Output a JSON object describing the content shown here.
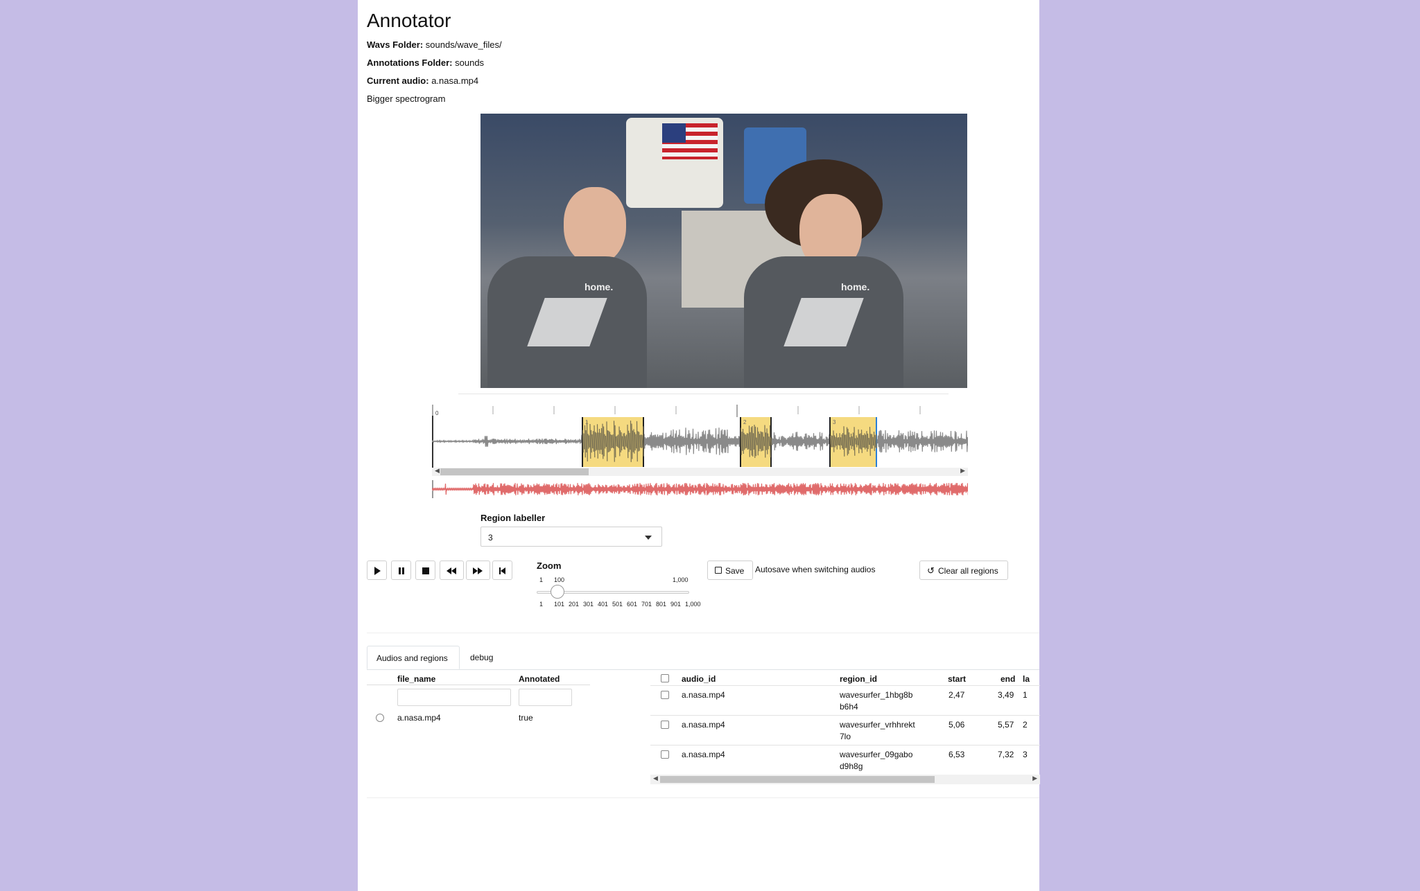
{
  "app": {
    "title": "Annotator"
  },
  "info": {
    "wavs_label": "Wavs Folder:",
    "wavs_value": "sounds/wave_files/",
    "annotations_label": "Annotations Folder:",
    "annotations_value": "sounds",
    "current_label": "Current audio:",
    "current_value": "a.nasa.mp4",
    "bigger": "Bigger spectrogram"
  },
  "video": {
    "shirt_text": "home."
  },
  "waveform": {
    "tick_label": "0",
    "region_labels": [
      "1",
      "2",
      "3"
    ],
    "region_color": "#f3d46a",
    "wave_color": "#8a8a8a",
    "minimap_color": "#e06b6b"
  },
  "region_labeller": {
    "label": "Region labeller",
    "value": "3"
  },
  "transport": {
    "icons": [
      "play-icon",
      "pause-icon",
      "stop-icon",
      "rewind-icon",
      "fast-forward-icon",
      "skip-back-icon"
    ]
  },
  "zoom": {
    "label": "Zoom",
    "min": "1",
    "value": "100",
    "max": "1,000",
    "ticks": [
      "1",
      "101",
      "201",
      "301",
      "401",
      "501",
      "601",
      "701",
      "801",
      "901",
      "1,000"
    ]
  },
  "actions": {
    "save": "Save",
    "autosave": "Autosave when switching audios",
    "clear": "Clear all regions"
  },
  "tabs": [
    {
      "label": "Audios and regions",
      "active": true
    },
    {
      "label": "debug",
      "active": false
    }
  ],
  "audios_table": {
    "headers": [
      "file_name",
      "Annotated"
    ],
    "rows": [
      {
        "file_name": "a.nasa.mp4",
        "annotated": "true"
      }
    ]
  },
  "regions_table": {
    "headers": [
      "audio_id",
      "region_id",
      "start",
      "end",
      "lal"
    ],
    "rows": [
      {
        "audio_id": "a.nasa.mp4",
        "region_id_1": "wavesurfer_1hbg8b",
        "region_id_2": "b6h4",
        "start": "2,47",
        "end": "3,49",
        "label": "1"
      },
      {
        "audio_id": "a.nasa.mp4",
        "region_id_1": "wavesurfer_vrhhrekt",
        "region_id_2": "7lo",
        "start": "5,06",
        "end": "5,57",
        "label": "2"
      },
      {
        "audio_id": "a.nasa.mp4",
        "region_id_1": "wavesurfer_09gabo",
        "region_id_2": "d9h8g",
        "start": "6,53",
        "end": "7,32",
        "label": "3"
      }
    ]
  }
}
